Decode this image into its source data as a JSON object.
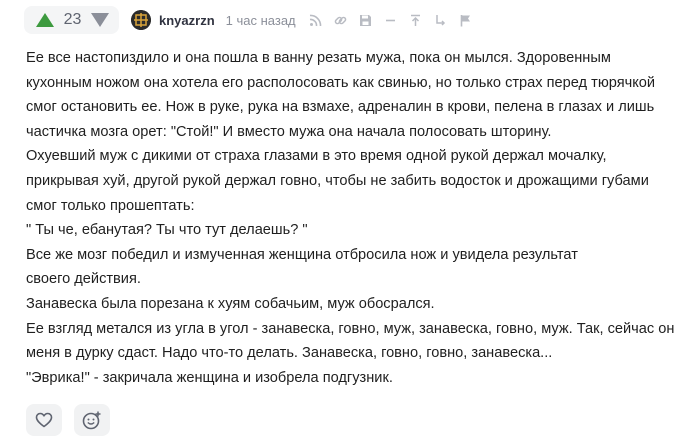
{
  "comment": {
    "rating": "23",
    "author": "knyazrzn",
    "time": "1 час назад",
    "lines": [
      "Ее все настопиздило и она пошла в ванну резать мужа, пока он мылся. Здоровенным",
      "кухонным ножом она хотела его располосовать как свинью, но только страх перед тюрячкой",
      "смог остановить ее. Нож в руке, рука на взмахе, адреналин в крови, пелена в глазах и лишь",
      "частичка мозга орет: \"Стой!\" И вместо мужа она начала полосовать шторину.",
      "Охуевший муж с дикими от страха глазами в это время одной рукой держал мочалку,",
      "прикрывая хуй, другой рукой держал говно, чтобы не забить водосток и дрожащими губами",
      "смог только прошептать:",
      "\" Ты че, ебанутая? Ты что тут делаешь? \"",
      "Все же мозг победил и измученная женщина отбросила нож и увидела результат",
      "своего действия.",
      "Занавеска была порезана к хуям собачьим, муж обосрался.",
      "Ее взгляд метался из угла в угол - занавеска, говно, муж, занавеска, говно, муж. Так, сейчас он",
      "меня в дурку сдаст. Надо что-то делать. Занавеска, говно, говно, занавеска...",
      "\"Эврика!\" - закричала женщина и изобрела подгузник."
    ]
  },
  "icons": {
    "upvote": "triangle-up-icon",
    "downvote": "triangle-down-icon",
    "tools": [
      "rss-icon",
      "link-icon",
      "save-icon",
      "minus-icon",
      "arrow-up-icon",
      "branch-icon",
      "flag-icon"
    ],
    "footer": [
      "heart-icon",
      "smile-icon"
    ]
  },
  "colors": {
    "upvote": "#3d9a3f",
    "downvote": "#8b8f99",
    "muted": "#b9bcc3"
  }
}
